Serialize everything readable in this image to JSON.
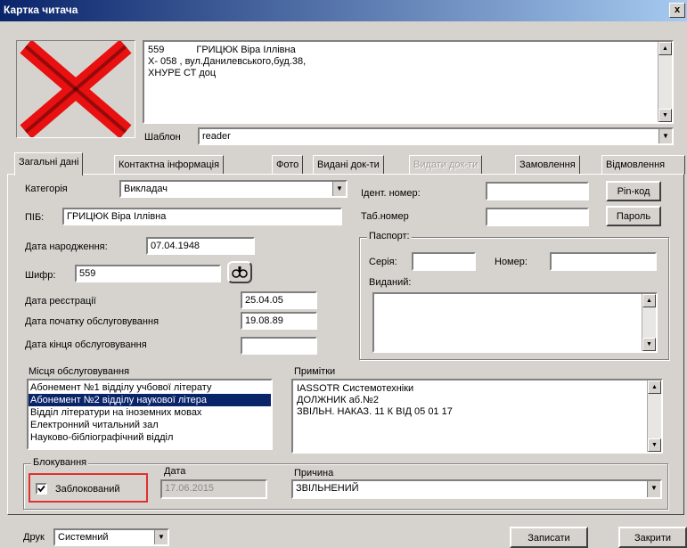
{
  "window": {
    "title": "Картка читача",
    "close_glyph": "x"
  },
  "reader_info": {
    "line1_id": "559",
    "line1_name": "ГРИЦЮК Віра Іллівна",
    "line2": "Х- 058 , вул.Данилевського,буд.38,",
    "line3": "ХНУРЕ СТ  доц"
  },
  "template": {
    "label": "Шаблон",
    "value": "reader"
  },
  "tabs": [
    {
      "label": "Загальні дані",
      "active": true,
      "disabled": false
    },
    {
      "label": "Контактна інформація",
      "active": false,
      "disabled": false
    },
    {
      "label": "Фото",
      "active": false,
      "disabled": false
    },
    {
      "label": "Видані док-ти",
      "active": false,
      "disabled": false
    },
    {
      "label": "Видати док-ти",
      "active": false,
      "disabled": true
    },
    {
      "label": "Замовлення",
      "active": false,
      "disabled": false
    },
    {
      "label": "Відмовлення",
      "active": false,
      "disabled": false
    }
  ],
  "general": {
    "category_label": "Категорія",
    "category_value": "Викладач",
    "pib_label": "ПІБ:",
    "pib_value": "ГРИЦЮК Віра Іллівна",
    "birth_label": "Дата народження:",
    "birth_value": "07.04.1948",
    "cipher_label": "Шифр:",
    "cipher_value": "559",
    "reg_label": "Дата реєстрації",
    "reg_value": "25.04.05",
    "start_label": "Дата початку обслуговування",
    "start_value": "19.08.89",
    "end_label": "Дата кінця обслуговування",
    "end_value": "",
    "ident_label": "Ідент. номер:",
    "ident_value": "",
    "tab_label": "Таб.номер",
    "tab_value": "",
    "pin_button": "Pin-код",
    "password_button": "Пароль",
    "passport_label": "Паспорт:",
    "series_label": "Серія:",
    "series_value": "",
    "number_label": "Номер:",
    "number_value": "",
    "issued_label": "Виданий:",
    "issued_value": ""
  },
  "service_places": {
    "label": "Місця обслуговування",
    "items": [
      {
        "text": "Абонемент №1 відділу учбової літерату",
        "selected": false
      },
      {
        "text": "Абонемент №2 відділу наукової літера",
        "selected": true
      },
      {
        "text": "Відділ літератури на іноземних мовах",
        "selected": false
      },
      {
        "text": "Електронний читальний зал",
        "selected": false
      },
      {
        "text": "Науково-бібліографічний відділ",
        "selected": false
      }
    ]
  },
  "notes": {
    "label": "Примітки",
    "line1": "IASSOTR Системотехніки",
    "line2": "ДОЛЖНИК аб.№2",
    "line3": "ЗВІЛЬН. НАКАЗ. 11 К ВІД 05 01 17"
  },
  "blocking": {
    "group_label": "Блокування",
    "checkbox_label": "Заблокований",
    "checked": true,
    "date_label": "Дата",
    "date_value": "17.06.2015",
    "reason_label": "Причина",
    "reason_value": "ЗВІЛЬНЕНИЙ",
    "highlight_color": "#e03030"
  },
  "footer": {
    "print_label": "Друк",
    "print_value": "Системний",
    "save_button": "Записати",
    "close_button": "Закрити"
  }
}
